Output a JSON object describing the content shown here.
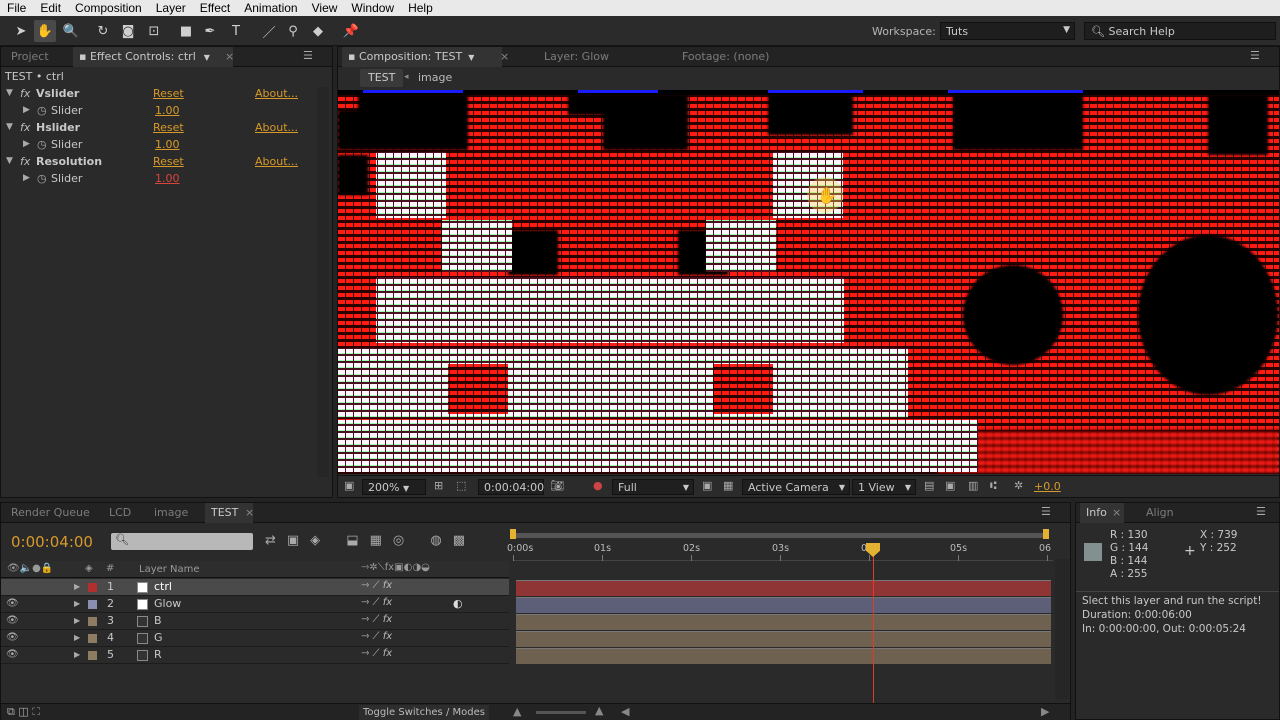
{
  "menu": [
    "File",
    "Edit",
    "Composition",
    "Layer",
    "Effect",
    "Animation",
    "View",
    "Window",
    "Help"
  ],
  "toolbar": {
    "workspace_label": "Workspace:",
    "workspace_value": "Tuts",
    "search_placeholder": "Search Help"
  },
  "left_panel": {
    "tabs": [
      "Project",
      "Effect Controls: ctrl"
    ],
    "breadcrumb": "TEST • ctrl",
    "effects": [
      {
        "name": "Vslider",
        "reset": "Reset",
        "about": "About...",
        "param": "Slider",
        "value": "1.00"
      },
      {
        "name": "Hslider",
        "reset": "Reset",
        "about": "About...",
        "param": "Slider",
        "value": "1.00"
      },
      {
        "name": "Resolution",
        "reset": "Reset",
        "about": "About...",
        "param": "Slider",
        "value": "1.00"
      }
    ]
  },
  "viewer": {
    "tabs": [
      "Composition: TEST",
      "Layer: Glow",
      "Footage: (none)"
    ],
    "flow": [
      "TEST",
      "image"
    ],
    "zoom": "200%",
    "timecode": "0:00:04:00",
    "resolution": "Full",
    "camera": "Active Camera",
    "views": "1 View",
    "exposure": "+0.0"
  },
  "timeline": {
    "tabs": [
      "Render Queue",
      "LCD",
      "image",
      "TEST"
    ],
    "timecode": "0:00:04:00",
    "layer_name_header": "Layer Name",
    "hash_header": "#",
    "ruler": [
      "0:00s",
      "01s",
      "02s",
      "03s",
      "04s",
      "05s",
      "06"
    ],
    "layers": [
      {
        "num": "1",
        "name": "ctrl",
        "label": "#b03030",
        "selected": true
      },
      {
        "num": "2",
        "name": "Glow",
        "label": "#8a8fb0",
        "selected": false
      },
      {
        "num": "3",
        "name": "B",
        "label": "#8d7b62",
        "selected": false
      },
      {
        "num": "4",
        "name": "G",
        "label": "#8d7b62",
        "selected": false
      },
      {
        "num": "5",
        "name": "R",
        "label": "#8d7b62",
        "selected": false
      }
    ],
    "toggle_label": "Toggle Switches / Modes"
  },
  "info_panel": {
    "tabs": [
      "Info",
      "Align"
    ],
    "r": "R : 130",
    "g": "G : 144",
    "b": "B : 144",
    "a": "A : 255",
    "x": "X : 739",
    "y": "Y : 252",
    "message": "Slect this layer and run the script!",
    "duration": "Duration: 0:00:06:00",
    "inout": "In: 0:00:00:00, Out: 0:00:05:24"
  },
  "colors": {
    "accent": "#d79a2a",
    "red_layer": "#8f3535",
    "purple_layer": "#5d5f78",
    "tan_layer": "#6e6150",
    "playhead": "#e23b2b"
  }
}
